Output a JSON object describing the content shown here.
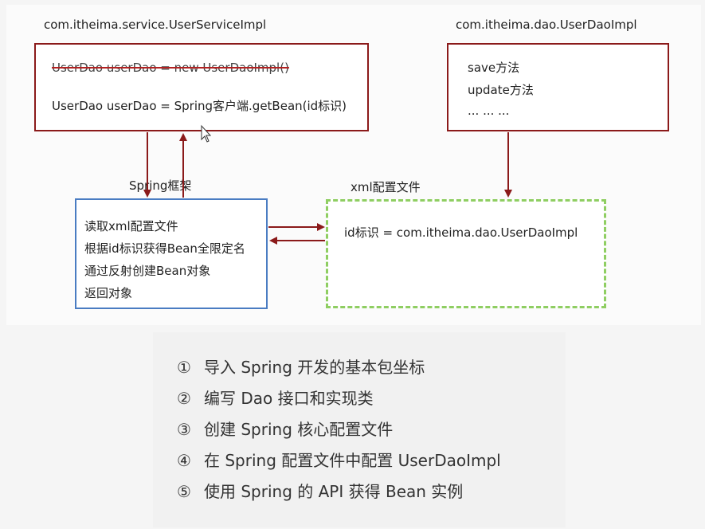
{
  "service": {
    "title": "com.itheima.service.UserServiceImpl",
    "line1": "UserDao userDao = new UserDaoImpl()",
    "line2": "UserDao userDao = Spring客户端.getBean(id标识)"
  },
  "dao": {
    "title": "com.itheima.dao.UserDaoImpl",
    "items": [
      "save方法",
      "update方法",
      "... ... ..."
    ]
  },
  "spring": {
    "title": "Spring框架",
    "items": [
      "读取xml配置文件",
      "根据id标识获得Bean全限定名",
      "通过反射创建Bean对象",
      "返回对象"
    ]
  },
  "xml": {
    "title": "xml配置文件",
    "content": "id标识 = com.itheima.dao.UserDaoImpl"
  },
  "steps": [
    {
      "num": "①",
      "text": "导入 Spring 开发的基本包坐标"
    },
    {
      "num": "②",
      "text": "编写 Dao 接口和实现类"
    },
    {
      "num": "③",
      "text": "创建 Spring 核心配置文件"
    },
    {
      "num": "④",
      "text": "在 Spring 配置文件中配置 UserDaoImpl"
    },
    {
      "num": "⑤",
      "text": "使用 Spring 的 API 获得 Bean 实例"
    }
  ],
  "colors": {
    "arrow": "#8b1a1a",
    "red_box": "#8b1a1a",
    "blue_box": "#4a7cc2",
    "green_box": "#8fce62"
  }
}
